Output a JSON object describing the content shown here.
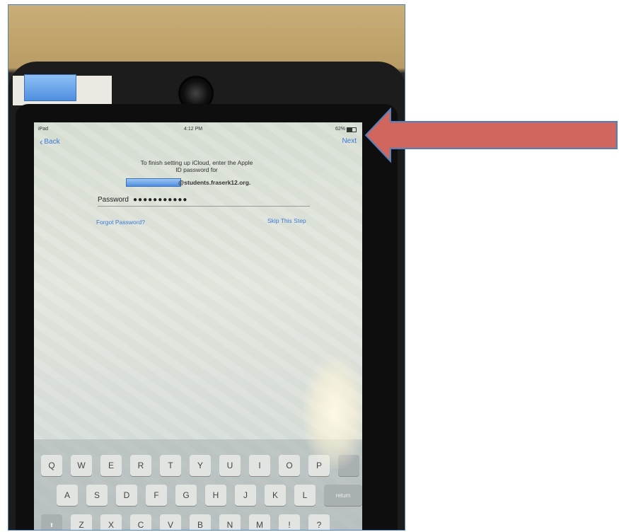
{
  "status_bar": {
    "carrier": "iPad",
    "time": "4:12 PM",
    "battery": "62%"
  },
  "nav": {
    "back_label": "Back",
    "next_label": "Next"
  },
  "instructions": {
    "line1": "To finish setting up iCloud, enter the Apple",
    "line2": "ID password for",
    "email_domain": "@students.fraserk12.org."
  },
  "password": {
    "label": "Password",
    "value": "●●●●●●●●●●●"
  },
  "links": {
    "forgot": "Forgot Password?",
    "skip": "Skip This Step"
  },
  "keyboard": {
    "row1": [
      "Q",
      "W",
      "E",
      "R",
      "T",
      "Y",
      "U",
      "I",
      "O",
      "P"
    ],
    "row2": [
      "A",
      "S",
      "D",
      "F",
      "G",
      "H",
      "J",
      "K",
      "L"
    ],
    "row2_action": "return",
    "row3": [
      "Z",
      "X",
      "C",
      "V",
      "B",
      "N",
      "M",
      "!",
      "?"
    ]
  },
  "colors": {
    "ios_blue": "#3a7bd5",
    "arrow": "#d0665d",
    "arrow_border": "#4f81bd"
  }
}
